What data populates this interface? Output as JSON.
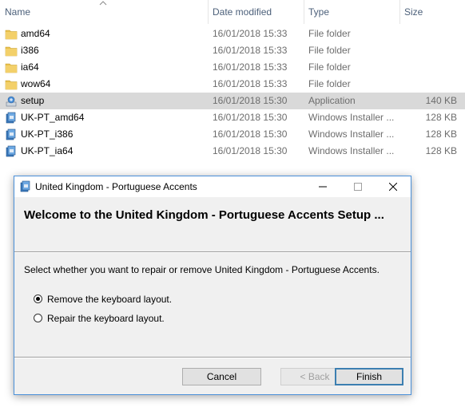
{
  "explorer": {
    "columns": {
      "name": "Name",
      "date": "Date modified",
      "type": "Type",
      "size": "Size"
    },
    "files": [
      {
        "name": "amd64",
        "date": "16/01/2018 15:33",
        "type": "File folder",
        "size": "",
        "icon": "folder-icon"
      },
      {
        "name": "i386",
        "date": "16/01/2018 15:33",
        "type": "File folder",
        "size": "",
        "icon": "folder-icon"
      },
      {
        "name": "ia64",
        "date": "16/01/2018 15:33",
        "type": "File folder",
        "size": "",
        "icon": "folder-icon"
      },
      {
        "name": "wow64",
        "date": "16/01/2018 15:33",
        "type": "File folder",
        "size": "",
        "icon": "folder-icon"
      },
      {
        "name": "setup",
        "date": "16/01/2018 15:30",
        "type": "Application",
        "size": "140 KB",
        "icon": "setup-app-icon",
        "selected": true
      },
      {
        "name": "UK-PT_amd64",
        "date": "16/01/2018 15:30",
        "type": "Windows Installer ...",
        "size": "128 KB",
        "icon": "installer-package-icon"
      },
      {
        "name": "UK-PT_i386",
        "date": "16/01/2018 15:30",
        "type": "Windows Installer ...",
        "size": "128 KB",
        "icon": "installer-package-icon"
      },
      {
        "name": "UK-PT_ia64",
        "date": "16/01/2018 15:30",
        "type": "Windows Installer ...",
        "size": "128 KB",
        "icon": "installer-package-icon"
      }
    ]
  },
  "dialog": {
    "title": "United Kingdom - Portuguese Accents",
    "heading": "Welcome to the United Kingdom - Portuguese Accents Setup ...",
    "prompt": "Select whether you want to repair or remove United Kingdom - Portuguese Accents.",
    "options": [
      {
        "label": "Remove the keyboard layout.",
        "selected": true
      },
      {
        "label": "Repair the keyboard layout.",
        "selected": false
      }
    ],
    "buttons": {
      "cancel": "Cancel",
      "back": "< Back",
      "finish": "Finish"
    }
  },
  "colors": {
    "selected_row": "#d9d9d9",
    "dialog_border": "#4a90d9",
    "folder": "#e8c14c",
    "accent": "#3c7fb1"
  }
}
